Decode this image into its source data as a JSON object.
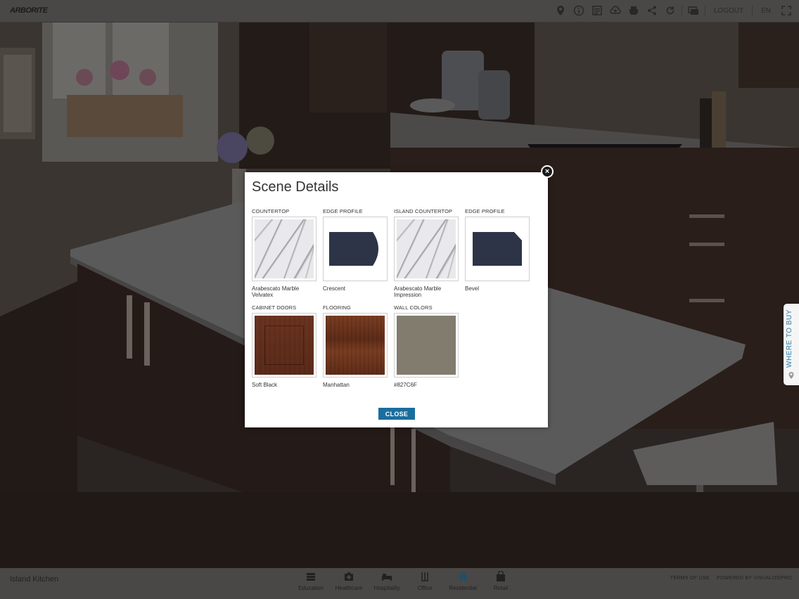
{
  "header": {
    "logo": "ARBORITE",
    "logout_label": "LOGOUT",
    "language_label": "EN",
    "icons": [
      "location-icon",
      "info-icon",
      "details-icon",
      "upload-icon",
      "print-icon",
      "share-icon",
      "reset-icon",
      "compare-icon",
      "fullscreen-icon"
    ]
  },
  "modal": {
    "title": "Scene Details",
    "close_button_label": "CLOSE",
    "close_icon": "×",
    "items": [
      {
        "label": "COUNTERTOP",
        "name": "Arabescato Marble Velvatex"
      },
      {
        "label": "EDGE PROFILE",
        "name": "Crescent"
      },
      {
        "label": "ISLAND COUNTERTOP",
        "name": "Arabescato Marble Impression"
      },
      {
        "label": "EDGE PROFILE",
        "name": "Bevel"
      },
      {
        "label": "CABINET DOORS",
        "name": "Soft Black"
      },
      {
        "label": "FLOORING",
        "name": "Manhattan"
      },
      {
        "label": "WALL COLORS",
        "name": "#827C6F"
      }
    ],
    "colors": {
      "edge_profile": "#2d3447",
      "wall_color": "#827C6F",
      "button": "#1a6e9e"
    }
  },
  "where_to_buy": {
    "label": "WHERE TO BUY"
  },
  "footer": {
    "scene_title": "Island Kitchen",
    "categories": [
      {
        "label": "Education",
        "icon": "education-icon"
      },
      {
        "label": "Healthcare",
        "icon": "healthcare-icon"
      },
      {
        "label": "Hospitality",
        "icon": "hospitality-icon"
      },
      {
        "label": "Office",
        "icon": "office-icon"
      },
      {
        "label": "Residential",
        "icon": "residential-icon"
      },
      {
        "label": "Retail",
        "icon": "retail-icon"
      }
    ],
    "terms_label": "TERMS OF USE",
    "powered_by_label": "POWERED BY VISUALIZEPRO"
  }
}
